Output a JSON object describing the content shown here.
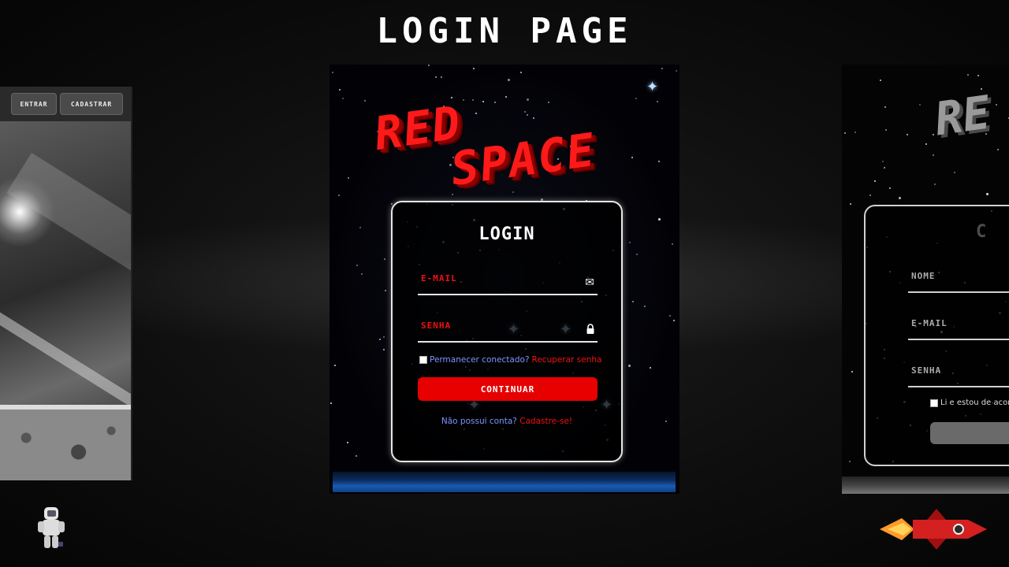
{
  "page_title": "LOGIN PAGE",
  "left_mock": {
    "nav": {
      "login_label": "ENTRAR",
      "signup_label": "CADASTRAR"
    }
  },
  "center_mock": {
    "logo": {
      "line1": "RED",
      "line2": "SPACE"
    },
    "login": {
      "title": "LOGIN",
      "email_placeholder": "E-MAIL",
      "password_placeholder": "SENHA",
      "remember_label": "Permanecer conectado?",
      "recover_link": "Recuperar senha",
      "continue_label": "CONTINUAR",
      "no_account_text": "Não possui conta?",
      "signup_link": "Cadastre-se!"
    }
  },
  "right_mock": {
    "logo": "RE",
    "card_title": "C",
    "fields": [
      "NOME",
      "E-MAIL",
      "SENHA"
    ],
    "terms_label": "Li e estou de acor"
  },
  "colors": {
    "accent_red": "#e60000",
    "link_blue": "#7d93ff"
  },
  "icons": {
    "email": "envelope-icon",
    "password": "lock-icon"
  }
}
